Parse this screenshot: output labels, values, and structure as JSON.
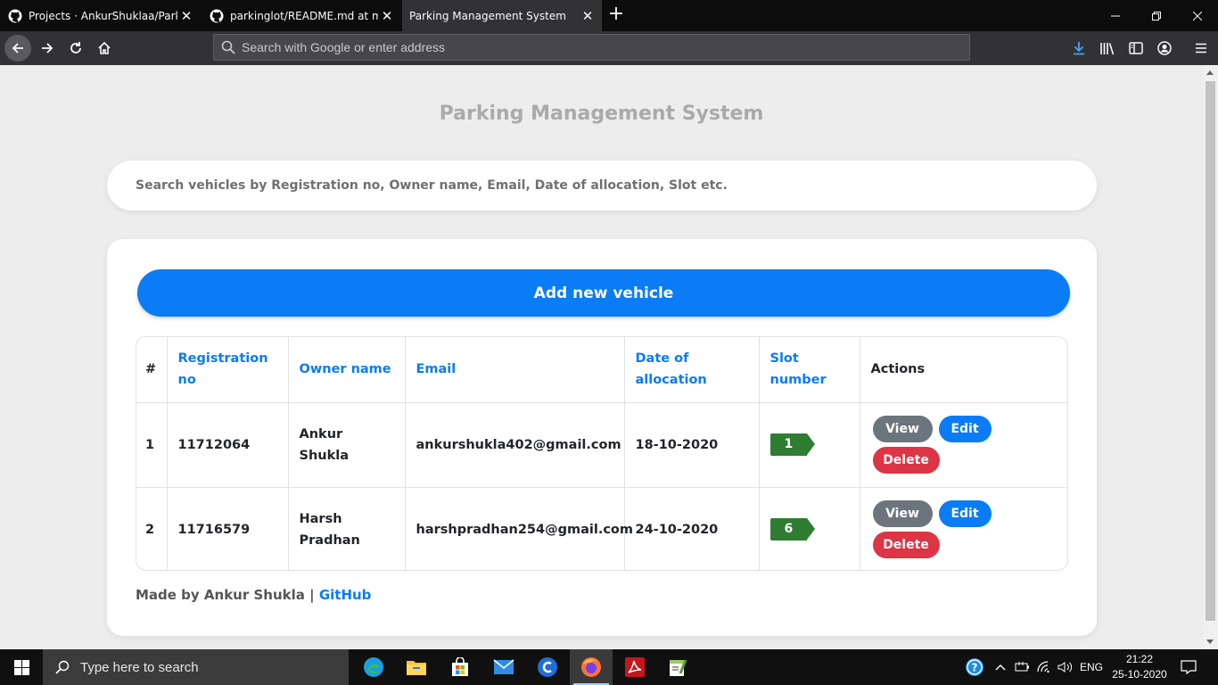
{
  "browser": {
    "tabs": [
      {
        "title": "Projects · AnkurShuklaa/Parkin",
        "icon": "github-icon"
      },
      {
        "title": "parkinglot/README.md at mas",
        "icon": "github-icon"
      },
      {
        "title": "Parking Management System",
        "icon": "none"
      }
    ],
    "url_placeholder": "Search with Google or enter address"
  },
  "page": {
    "title": "Parking Management System",
    "search_placeholder": "Search vehicles by Registration no, Owner name, Email, Date of allocation, Slot etc.",
    "add_button": "Add new vehicle",
    "table": {
      "headers": {
        "num": "#",
        "registration": "Registration no",
        "owner": "Owner name",
        "email": "Email",
        "date": "Date of allocation",
        "slot": "Slot number",
        "actions": "Actions"
      },
      "rows": [
        {
          "num": "1",
          "registration": "11712064",
          "owner": "Ankur Shukla",
          "email": "ankurshukla402@gmail.com",
          "date": "18-10-2020",
          "slot": "1"
        },
        {
          "num": "2",
          "registration": "11716579",
          "owner": "Harsh Pradhan",
          "email": "harshpradhan254@gmail.com",
          "date": "24-10-2020",
          "slot": "6"
        }
      ],
      "action_labels": {
        "view": "View",
        "edit": "Edit",
        "delete": "Delete"
      }
    },
    "footer": {
      "text": "Made by Ankur Shukla |",
      "link": "GitHub"
    }
  },
  "taskbar": {
    "search_placeholder": "Type here to search",
    "language": "ENG",
    "time": "21:22",
    "date": "25-10-2020"
  },
  "colors": {
    "primary": "#0a7cf5",
    "secondary": "#6c757d",
    "danger": "#dc3545",
    "slot_badge": "#2e7d32"
  }
}
